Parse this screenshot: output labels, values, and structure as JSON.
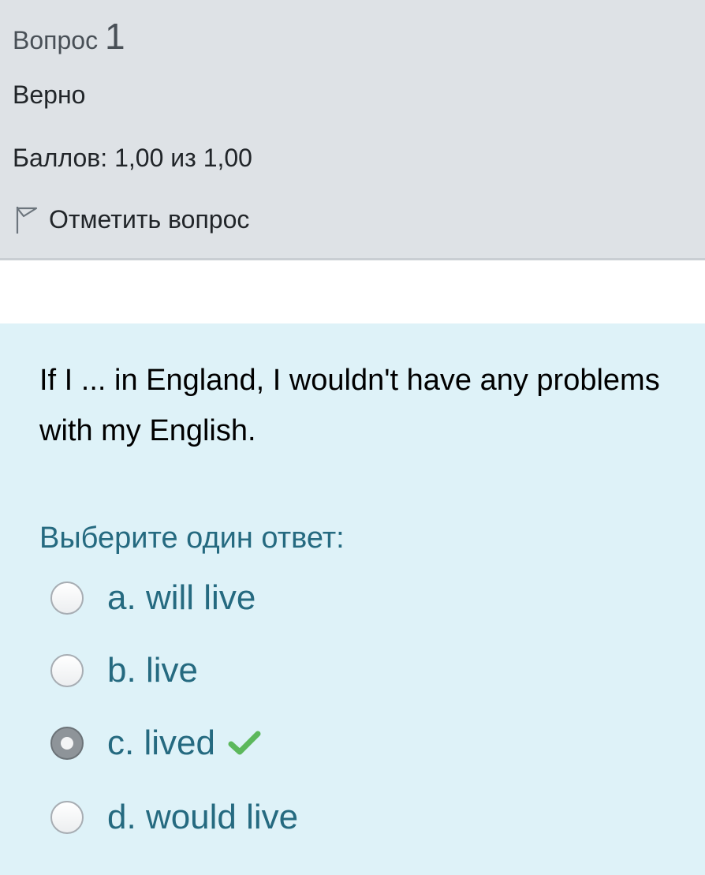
{
  "info": {
    "heading_prefix": "Вопрос",
    "question_number": "1",
    "state": "Верно",
    "grade": "Баллов: 1,00 из 1,00",
    "flag_label": "Отметить вопрос"
  },
  "question": {
    "text": "If I ...  in England, I wouldn't have any problems with my English.",
    "prompt": "Выберите один ответ:",
    "options": [
      {
        "letter": "a.",
        "text": "will live",
        "selected": false
      },
      {
        "letter": "b.",
        "text": "live",
        "selected": false
      },
      {
        "letter": "c.",
        "text": "lived",
        "selected": true,
        "correct": true
      },
      {
        "letter": "d.",
        "text": "would live",
        "selected": false
      }
    ]
  },
  "colors": {
    "info_bg": "#dee2e6",
    "content_bg": "#def2f8",
    "answer_text": "#256a80",
    "correct_check": "#5cb85c"
  },
  "icons": {
    "flag": "flag-icon",
    "correct": "check-icon"
  }
}
